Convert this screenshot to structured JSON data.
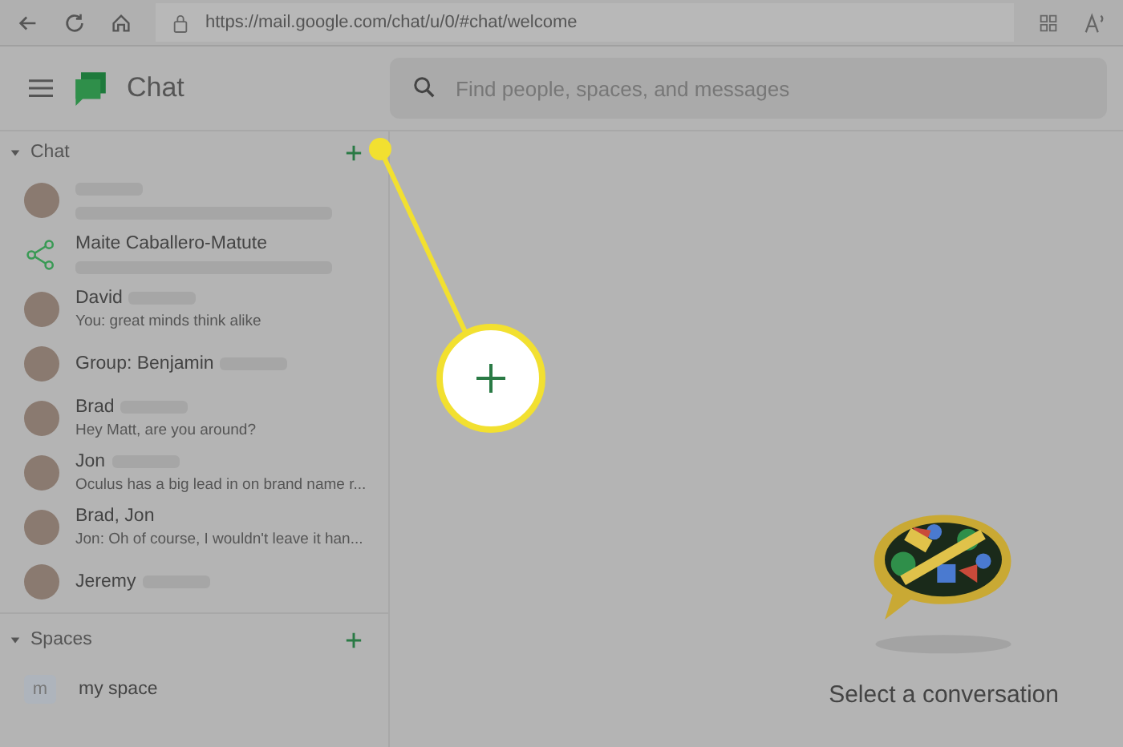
{
  "browser": {
    "url": "https://mail.google.com/chat/u/0/#chat/welcome"
  },
  "header": {
    "app_title": "Chat",
    "search": {
      "placeholder": "Find people, spaces, and messages"
    }
  },
  "sidebar": {
    "chat_section": {
      "title": "Chat",
      "expanded": true,
      "items": [
        {
          "kind": "person",
          "name_redacted": true,
          "message_redacted": true
        },
        {
          "kind": "group",
          "name": "Maite Caballero-Matute",
          "message_redacted": true
        },
        {
          "kind": "person",
          "name": "David",
          "name_redacted": true,
          "message": "You: great minds think alike"
        },
        {
          "kind": "person",
          "name": "Group: Benjamin",
          "name_redacted": true
        },
        {
          "kind": "person",
          "name": "Brad",
          "name_redacted": true,
          "message": "Hey Matt, are you around?"
        },
        {
          "kind": "person",
          "name": "Jon",
          "name_redacted": true,
          "message": "Oculus has a big lead in on brand name r..."
        },
        {
          "kind": "person",
          "name": "Brad, Jon",
          "message": "Jon: Oh of course, I wouldn't leave it han..."
        },
        {
          "kind": "person",
          "name": "Jeremy",
          "name_redacted": true
        }
      ]
    },
    "spaces_section": {
      "title": "Spaces",
      "expanded": true,
      "items": [
        {
          "initial": "m",
          "name": "my space"
        }
      ]
    }
  },
  "main": {
    "empty_state": "Select a conversation"
  }
}
